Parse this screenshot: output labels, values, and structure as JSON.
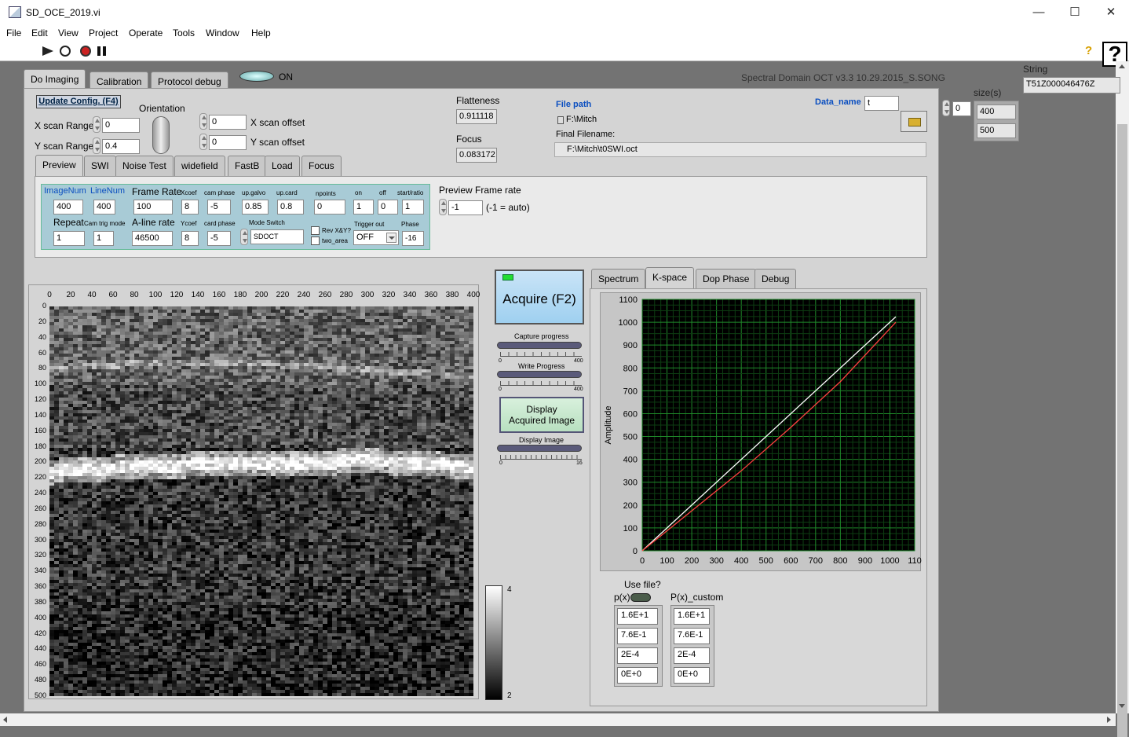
{
  "window": {
    "title": "SD_OCE_2019.vi",
    "minimize": "—",
    "maximize": "☐",
    "close": "✕"
  },
  "menu": [
    "File",
    "Edit",
    "View",
    "Project",
    "Operate",
    "Tools",
    "Window",
    "Help"
  ],
  "toolbar": {
    "help": "?"
  },
  "top_tabs": [
    "Do Imaging",
    "Calibration",
    "Protocol debug"
  ],
  "on_label": "ON",
  "version_text": "Spectral Domain OCT v3.3  10.29.2015_S.SONG",
  "string_panel": {
    "label": "String",
    "value": "T51Z000046476Z",
    "size_label": "size(s)",
    "index": "0",
    "sizes": [
      "400",
      "500"
    ]
  },
  "config": {
    "update_btn": "Update Config. (F4)",
    "orientation": "Orientation",
    "x_scan_range_label": "X scan Range",
    "x_scan_range": "0",
    "y_scan_range_label": "Y scan Range",
    "y_scan_range": "0.4",
    "x_offset_label": "X scan offset",
    "x_offset": "0",
    "y_offset_label": "Y scan offset",
    "y_offset": "0",
    "flatness_label": "Flatteness",
    "flatness": "0.911118",
    "focus_label": "Focus",
    "focus": "0.083172",
    "file_path_label": "File path",
    "file_path": "F:\\Mitch",
    "data_name_label": "Data_name",
    "data_name": "t",
    "final_filename_label": "Final Filename:",
    "final_filename": "F:\\Mitch\\t0SWI.oct"
  },
  "sub_tabs": [
    "Preview",
    "SWI",
    "Noise Test",
    "widefield",
    "FastB",
    "Load",
    "Focus"
  ],
  "preview": {
    "imagenum_label": "ImageNum",
    "imagenum": "400",
    "linenum_label": "LineNum",
    "linenum": "400",
    "framerate_label": "Frame Rate",
    "framerate": "100",
    "xcoef_label": "Xcoef",
    "xcoef": "8",
    "camphase_label": "cam phase",
    "camphase": "-5",
    "upgalvo_label": "up.galvo",
    "upgalvo": "0.85",
    "upcard_label": "up.card",
    "upcard": "0.8",
    "npoints_label": "npoints",
    "npoints": "0",
    "on_label": "on",
    "on": "1",
    "off_label": "off",
    "off": "0",
    "startratio_label": "start/ratio",
    "startratio": "1",
    "repeat_label": "Repeat",
    "repeat": "1",
    "camtrig_label": "Cam trig mode",
    "camtrig": "1",
    "alinerate_label": "A-line rate",
    "alinerate": "46500",
    "ycoef_label": "Ycoef",
    "ycoef": "8",
    "cardphase_label": "card phase",
    "cardphase": "-5",
    "modeswitch_label": "Mode Switch",
    "modeswitch": "SDOCT",
    "revxy_label": "Rev X&Y?",
    "twoarea_label": "two_area",
    "triggerout_label": "Trigger out",
    "triggerout": "OFF",
    "phase_label": "Phase",
    "phase": "-16",
    "pfr_label": "Preview Frame rate",
    "pfr": "-1",
    "pfr_note": "(-1 = auto)"
  },
  "image": {
    "x_ticks": [
      "0",
      "20",
      "40",
      "60",
      "80",
      "100",
      "120",
      "140",
      "160",
      "180",
      "200",
      "220",
      "240",
      "260",
      "280",
      "300",
      "320",
      "340",
      "360",
      "380",
      "400"
    ],
    "y_ticks": [
      "0",
      "20",
      "40",
      "60",
      "80",
      "100",
      "120",
      "140",
      "160",
      "180",
      "200",
      "220",
      "240",
      "260",
      "280",
      "300",
      "320",
      "340",
      "360",
      "380",
      "400",
      "420",
      "440",
      "460",
      "480",
      "500"
    ],
    "colorbar_max": "4",
    "colorbar_min": "2"
  },
  "controls": {
    "acquire": "Acquire (F2)",
    "capture_label": "Capture progress",
    "capture_max": "400",
    "capture_min": "0",
    "write_label": "Write Progress",
    "write_max": "400",
    "write_min": "0",
    "display_btn_line1": "Display",
    "display_btn_line2": "Acquired Image",
    "display_label": "Display Image",
    "display_max": "16",
    "display_min": "0"
  },
  "right_tabs": [
    "Spectrum",
    "K-space",
    "Dop Phase",
    "Debug"
  ],
  "chart_data": {
    "type": "line",
    "ylabel": "Amplitude",
    "xlim": [
      0,
      1100
    ],
    "ylim": [
      0,
      1100
    ],
    "x_ticks": [
      "0",
      "100",
      "200",
      "300",
      "400",
      "500",
      "600",
      "700",
      "800",
      "900",
      "1000",
      "110"
    ],
    "y_ticks": [
      "0",
      "100",
      "200",
      "300",
      "400",
      "500",
      "600",
      "700",
      "800",
      "900",
      "1000",
      "1100"
    ],
    "grid": true,
    "series": [
      {
        "color": "#ffffff",
        "x": [
          0,
          1024
        ],
        "y": [
          0,
          1024
        ]
      },
      {
        "color": "#ff4040",
        "x": [
          0,
          200,
          400,
          600,
          800,
          1024
        ],
        "y": [
          0,
          175,
          350,
          540,
          740,
          1000
        ]
      }
    ]
  },
  "use_file": {
    "label": "Use file?",
    "px_label": "p(x)",
    "pcustom_label": "P(x)_custom",
    "px": [
      "1.6E+1",
      "7.6E-1",
      "2E-4",
      "0E+0"
    ],
    "pcustom": [
      "1.6E+1",
      "7.6E-1",
      "2E-4",
      "0E+0"
    ]
  }
}
